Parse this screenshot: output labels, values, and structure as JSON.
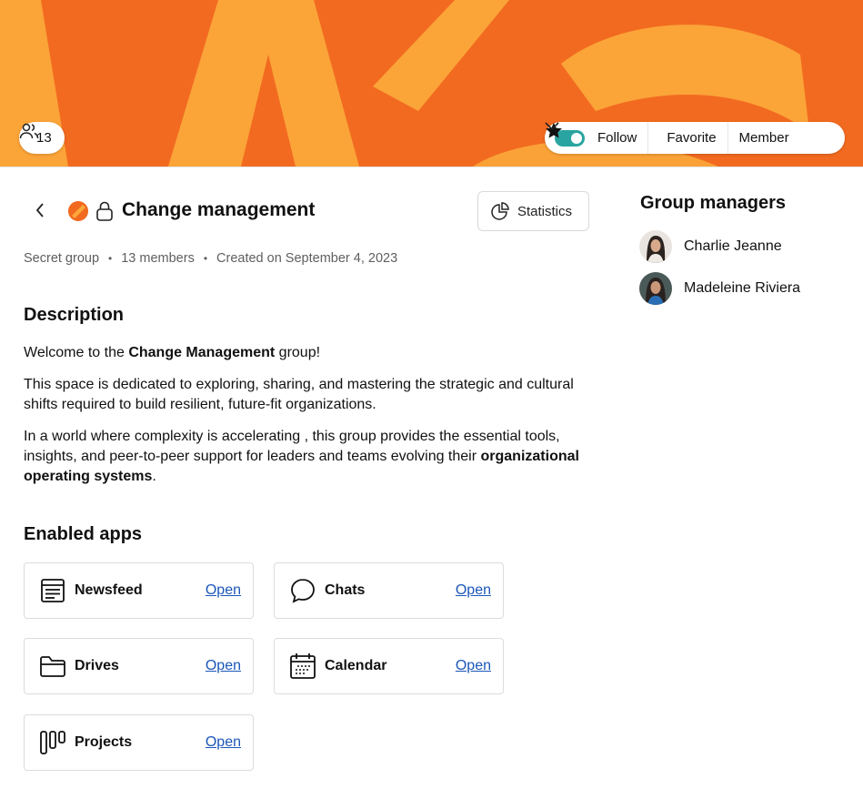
{
  "banner": {
    "members_count": "13",
    "follow_label": "Follow",
    "favorite_label": "Favorite",
    "role_label": "Member",
    "colors": {
      "background": "#f26a20",
      "stripes": "#fba83a",
      "toggle": "#2aa4a0"
    }
  },
  "header": {
    "title": "Change management",
    "statistics_label": "Statistics"
  },
  "meta": {
    "privacy": "Secret group",
    "members": "13 members",
    "created": "Created on September 4, 2023"
  },
  "description": {
    "heading": "Description",
    "p1_pre": "Welcome to the ",
    "p1_bold": "Change Management",
    "p1_post": " group!",
    "p2": "This space is dedicated to exploring, sharing, and mastering the strategic and cultural shifts required to build resilient, future-fit organizations.",
    "p3_pre": "In a world where complexity is accelerating , this group provides the essential tools, insights, and peer-to-peer support for leaders and teams evolving their ",
    "p3_bold": "organizational operating systems",
    "p3_post": "."
  },
  "apps": {
    "heading": "Enabled apps",
    "items": [
      {
        "name": "Newsfeed",
        "open": "Open",
        "icon": "newsfeed-icon"
      },
      {
        "name": "Chats",
        "open": "Open",
        "icon": "chat-icon"
      },
      {
        "name": "Drives",
        "open": "Open",
        "icon": "folder-icon"
      },
      {
        "name": "Calendar",
        "open": "Open",
        "icon": "calendar-icon"
      },
      {
        "name": "Projects",
        "open": "Open",
        "icon": "kanban-icon"
      }
    ]
  },
  "managers": {
    "heading": "Group managers",
    "items": [
      {
        "name": "Charlie Jeanne"
      },
      {
        "name": "Madeleine Riviera"
      }
    ]
  }
}
